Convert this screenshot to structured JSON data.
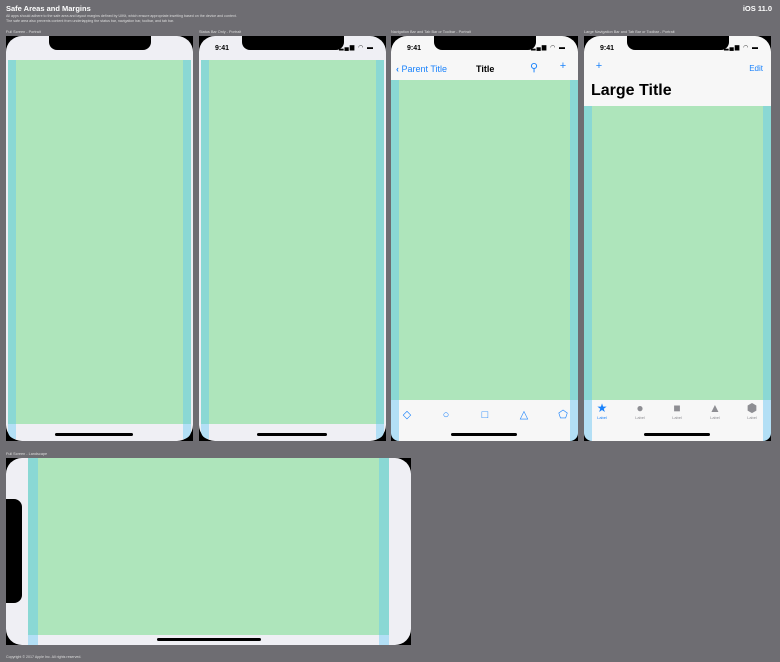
{
  "header": {
    "title": "Safe Areas and Margins",
    "version": "iOS 11.0",
    "description": [
      "All apps should adhere to the safe area and layout margins defined by UIKit, which ensure appropriate insetting based on the device and context.",
      "The safe area also prevents content from underlapping the status bar, navigation bar, toolbar, and tab bar."
    ]
  },
  "frames": {
    "f1": {
      "caption": "Full Screen - Portrait"
    },
    "f2": {
      "caption": "Status Bar Only - Portrait",
      "time": "9:41"
    },
    "f3": {
      "caption": "Navigation Bar and Tab Bar or Toolbar - Portrait",
      "time": "9:41",
      "back": "Parent Title",
      "title": "Title",
      "toolbar_icons": [
        "diamond-icon",
        "circle-icon",
        "square-icon",
        "triangle-icon",
        "pentagon-icon"
      ]
    },
    "f4": {
      "caption": "Large Navigation Bar and Tab Bar or Toolbar - Portrait",
      "time": "9:41",
      "edit": "Edit",
      "large_title": "Large Title",
      "tabs": [
        {
          "label": "Label",
          "icon": "star-icon",
          "active": true
        },
        {
          "label": "Label",
          "icon": "circle-icon"
        },
        {
          "label": "Label",
          "icon": "square-icon"
        },
        {
          "label": "Label",
          "icon": "triangle-icon"
        },
        {
          "label": "Label",
          "icon": "hexagon-icon"
        }
      ]
    },
    "f5": {
      "caption": "Full Screen - Landscape"
    }
  },
  "footer": {
    "copyright": "Copyright © 2017 Apple Inc. All rights reserved."
  },
  "colors": {
    "background": "#6e6d72",
    "safe_area": "#aee5bb",
    "margin": "#8ad8d4",
    "accent": "#1a82fb"
  }
}
